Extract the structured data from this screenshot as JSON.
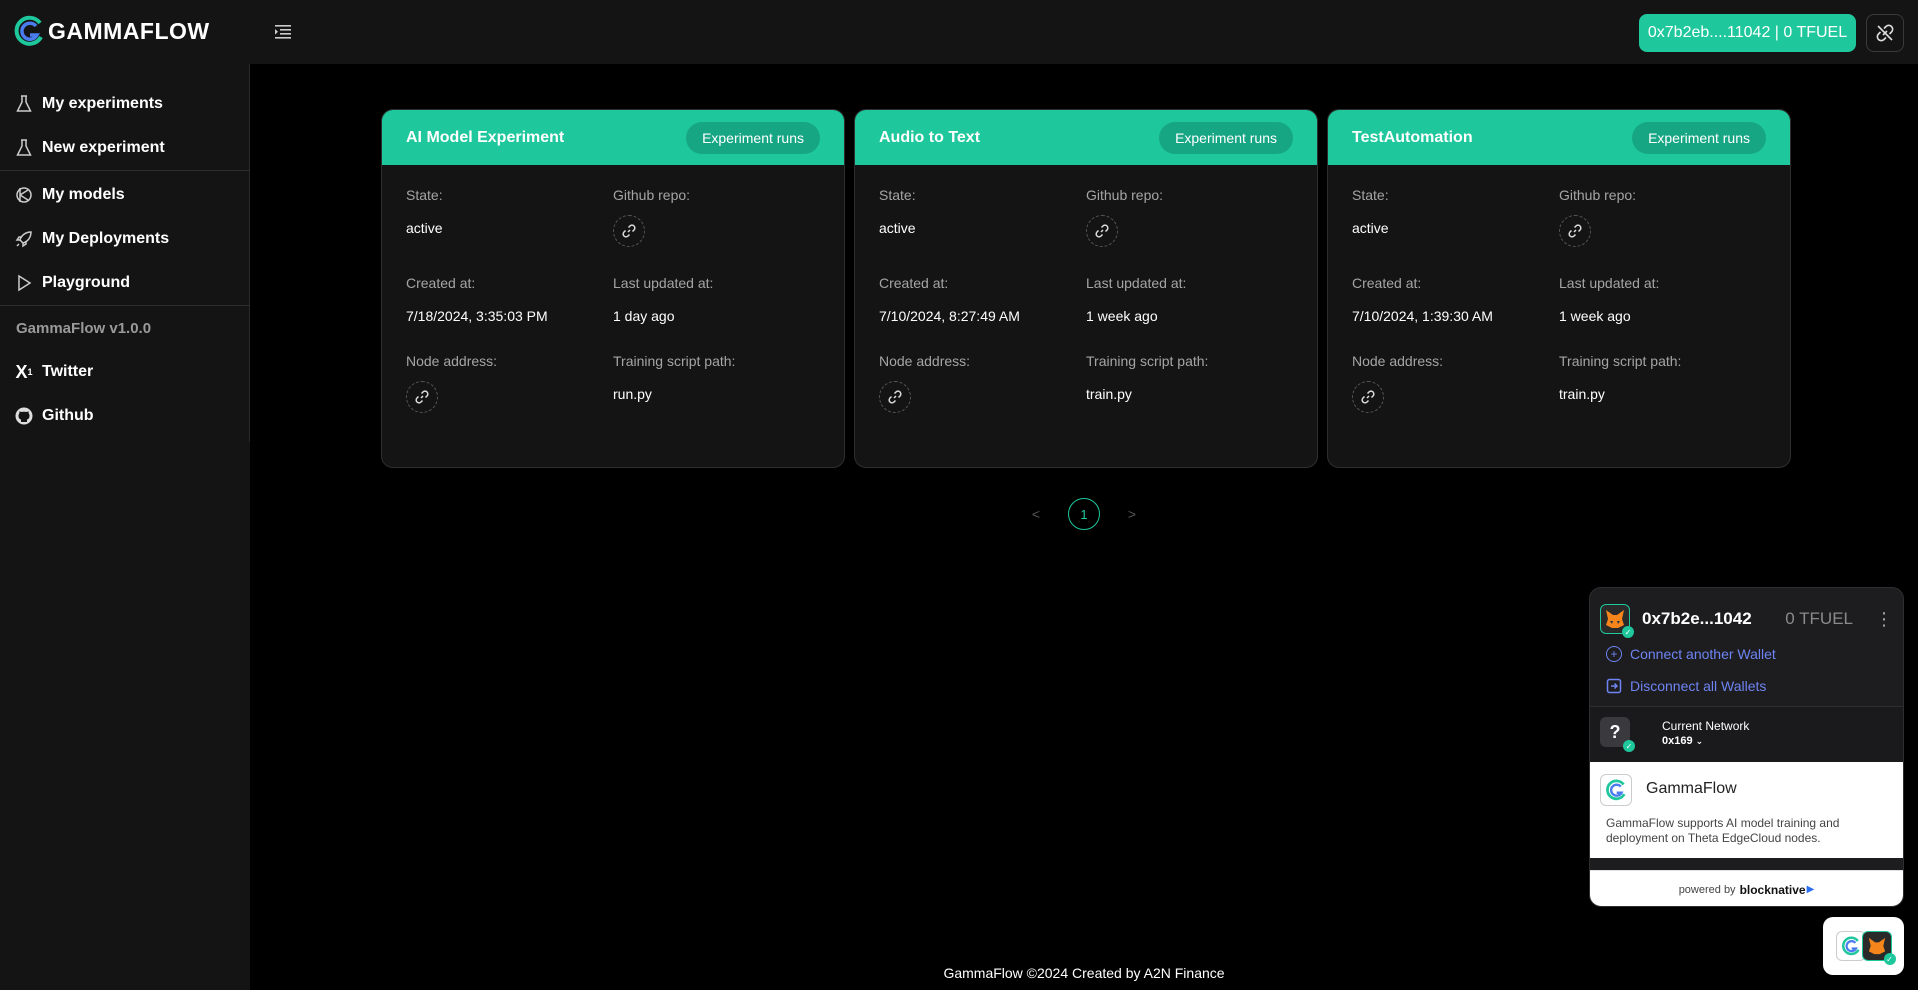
{
  "app": {
    "name": "GAMMAFLOW",
    "wallet_button": "0x7b2eb....11042 | 0 TFUEL"
  },
  "sidebar": {
    "items": [
      {
        "label": "My experiments",
        "icon": "flask-icon"
      },
      {
        "label": "New experiment",
        "icon": "flask-icon"
      },
      {
        "label": "My models",
        "icon": "model-icon"
      },
      {
        "label": "My Deployments",
        "icon": "rocket-icon"
      },
      {
        "label": "Playground",
        "icon": "play-icon"
      }
    ],
    "version": "GammaFlow v1.0.0",
    "links": [
      {
        "label": "Twitter",
        "icon": "x-icon"
      },
      {
        "label": "Github",
        "icon": "github-icon"
      }
    ]
  },
  "labels": {
    "state": "State:",
    "github_repo": "Github repo:",
    "created_at": "Created at:",
    "last_updated": "Last updated at:",
    "node_address": "Node address:",
    "training_script": "Training script path:",
    "experiment_runs": "Experiment runs"
  },
  "experiments": [
    {
      "title": "AI Model Experiment",
      "state": "active",
      "created": "7/18/2024, 3:35:03 PM",
      "updated": "1 day ago",
      "script": "run.py"
    },
    {
      "title": "Audio to Text",
      "state": "active",
      "created": "7/10/2024, 8:27:49 AM",
      "updated": "1 week ago",
      "script": "train.py"
    },
    {
      "title": "TestAutomation",
      "state": "active",
      "created": "7/10/2024, 1:39:30 AM",
      "updated": "1 week ago",
      "script": "train.py"
    }
  ],
  "pagination": {
    "prev": "<",
    "current": "1",
    "next": ">"
  },
  "footer": "GammaFlow ©2024 Created by A2N Finance",
  "wallet_panel": {
    "address": "0x7b2e...1042",
    "balance": "0 TFUEL",
    "connect_another": "Connect another Wallet",
    "disconnect_all": "Disconnect all Wallets",
    "network_label": "Current Network",
    "network_value": "0x169",
    "dapp_name": "GammaFlow",
    "dapp_desc": "GammaFlow supports AI model training and deployment on Theta EdgeCloud nodes.",
    "powered_by": "powered by",
    "powered_brand": "blocknative"
  },
  "colors": {
    "accent": "#1ec79c",
    "bg": "#000000",
    "panel": "#141414",
    "link": "#6e84f2"
  }
}
